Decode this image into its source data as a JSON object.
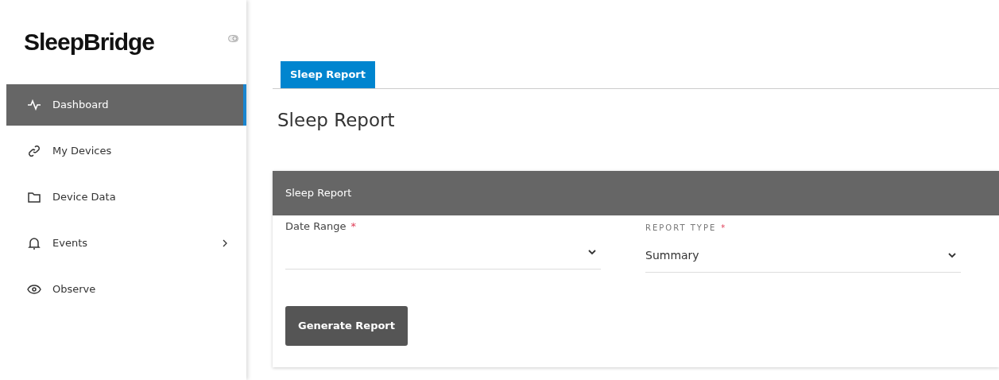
{
  "sidebar": {
    "logo": "SleepBridge",
    "items": [
      {
        "label": "Dashboard",
        "selected": true,
        "has_submenu": false
      },
      {
        "label": "My Devices",
        "selected": false,
        "has_submenu": false
      },
      {
        "label": "Device Data",
        "selected": false,
        "has_submenu": false
      },
      {
        "label": "Events",
        "selected": false,
        "has_submenu": true
      },
      {
        "label": "Observe",
        "selected": false,
        "has_submenu": false
      }
    ]
  },
  "tabs": [
    {
      "label": "Sleep Report",
      "selected": true
    }
  ],
  "page_title": "Sleep Report",
  "card": {
    "title": "Sleep Report",
    "fields": [
      {
        "label": "Date Range",
        "required_mark": "*"
      },
      {
        "label": "REPORT TYPE",
        "required_mark": "*",
        "value": "Summary"
      }
    ],
    "button": "Generate Report"
  }
}
